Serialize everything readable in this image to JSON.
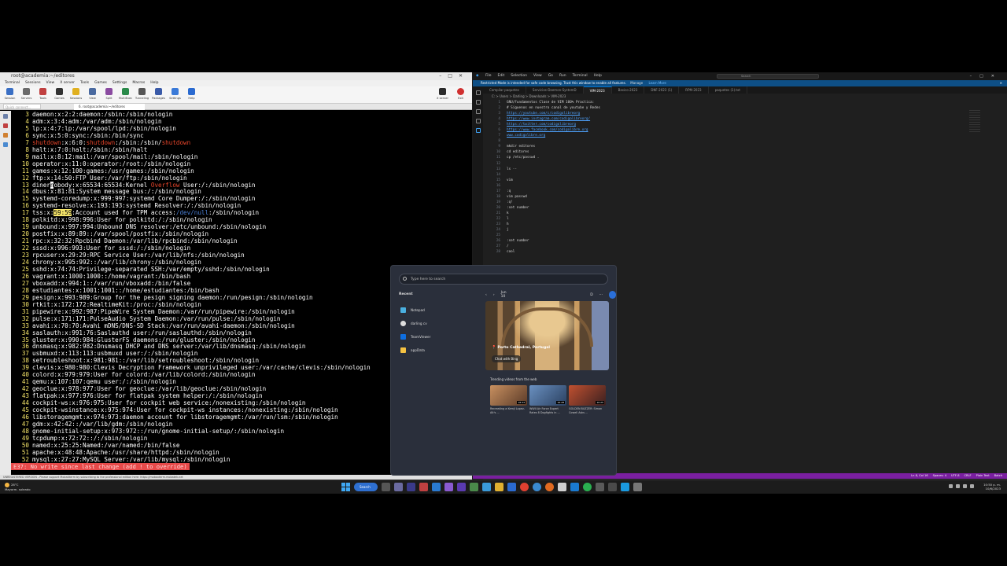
{
  "moba": {
    "title": "root@academia:~/editores",
    "menu": [
      "Terminal",
      "Sessions",
      "View",
      "X server",
      "Tools",
      "Games",
      "Settings",
      "Macros",
      "Help"
    ],
    "toolbar": [
      "Session",
      "Servers",
      "Tools",
      "Games",
      "Sessions",
      "View",
      "Split",
      "MultiExec",
      "Tunneling",
      "Packages",
      "Settings",
      "Help"
    ],
    "toolbar_right": [
      "X server",
      "Exit"
    ],
    "tab_label": "6. root@academia:~/editores",
    "quick_connect": "Quick connect...",
    "lines": [
      [
        "3",
        "daemon:x:2:2:daemon:/sbin:/sbin/nologin"
      ],
      [
        "4",
        "adm:x:3:4:adm:/var/adm:/sbin/nologin"
      ],
      [
        "5",
        "lp:x:4:7:lp:/var/spool/lpd:/sbin/nologin"
      ],
      [
        "6",
        "sync:x:5:0:sync:/sbin:/bin/sync"
      ],
      [
        "7",
        "shutdown:x:6:0:shutdown:/sbin:/sbin/shutdown"
      ],
      [
        "8",
        "halt:x:7:0:halt:/sbin:/sbin/halt"
      ],
      [
        "9",
        "mail:x:8:12:mail:/var/spool/mail:/sbin/nologin"
      ],
      [
        "10",
        "operator:x:11:0:operator:/root:/sbin/nologin"
      ],
      [
        "11",
        "games:x:12:100:games:/usr/games:/sbin/nologin"
      ],
      [
        "12",
        "ftp:x:14:50:FTP User:/var/ftp:/sbin/nologin"
      ],
      [
        "13",
        "dinernobody:x:65534:65534:Kernel Overflow User:/:/sbin/nologin"
      ],
      [
        "14",
        "dbus:x:81:81:System message bus:/:/sbin/nologin"
      ],
      [
        "15",
        "systemd-coredump:x:999:997:systemd Core Dumper:/:/sbin/nologin"
      ],
      [
        "16",
        "systemd-resolve:x:193:193:systemd Resolver:/:/sbin/nologin"
      ],
      [
        "17",
        "tss:x:59:59:Account used for TPM access:/dev/null:/sbin/nologin"
      ],
      [
        "18",
        "polkitd:x:998:996:User for polkitd:/:/sbin/nologin"
      ],
      [
        "19",
        "unbound:x:997:994:Unbound DNS resolver:/etc/unbound:/sbin/nologin"
      ],
      [
        "20",
        "postfix:x:89:89::/var/spool/postfix:/sbin/nologin"
      ],
      [
        "21",
        "rpc:x:32:32:Rpcbind Daemon:/var/lib/rpcbind:/sbin/nologin"
      ],
      [
        "22",
        "sssd:x:996:993:User for sssd:/:/sbin/nologin"
      ],
      [
        "23",
        "rpcuser:x:29:29:RPC Service User:/var/lib/nfs:/sbin/nologin"
      ],
      [
        "24",
        "chrony:x:995:992::/var/lib/chrony:/sbin/nologin"
      ],
      [
        "25",
        "sshd:x:74:74:Privilege-separated SSH:/var/empty/sshd:/sbin/nologin"
      ],
      [
        "26",
        "vagrant:x:1000:1000::/home/vagrant:/bin/bash"
      ],
      [
        "27",
        "vboxadd:x:994:1::/var/run/vboxadd:/bin/false"
      ],
      [
        "28",
        "estudiantes:x:1001:1001::/home/estudiantes:/bin/bash"
      ],
      [
        "29",
        "pesign:x:993:989:Group for the pesign signing daemon:/run/pesign:/sbin/nologin"
      ],
      [
        "30",
        "rtkit:x:172:172:RealtimeKit:/proc:/sbin/nologin"
      ],
      [
        "31",
        "pipewire:x:992:987:PipeWire System Daemon:/var/run/pipewire:/sbin/nologin"
      ],
      [
        "32",
        "pulse:x:171:171:PulseAudio System Daemon:/var/run/pulse:/sbin/nologin"
      ],
      [
        "33",
        "avahi:x:70:70:Avahi mDNS/DNS-SD Stack:/var/run/avahi-daemon:/sbin/nologin"
      ],
      [
        "34",
        "saslauth:x:991:76:Saslauthd user:/run/saslauthd:/sbin/nologin"
      ],
      [
        "35",
        "gluster:x:990:984:GlusterFS daemons:/run/gluster:/sbin/nologin"
      ],
      [
        "36",
        "dnsmasq:x:982:982:Dnsmasq DHCP and DNS server:/var/lib/dnsmasq:/sbin/nologin"
      ],
      [
        "37",
        "usbmuxd:x:113:113:usbmuxd user:/:/sbin/nologin"
      ],
      [
        "38",
        "setroubleshoot:x:981:981::/var/lib/setroubleshoot:/sbin/nologin"
      ],
      [
        "39",
        "clevis:x:980:980:Clevis Decryption Framework unprivileged user:/var/cache/clevis:/sbin/nologin"
      ],
      [
        "40",
        "colord:x:979:979:User for colord:/var/lib/colord:/sbin/nologin"
      ],
      [
        "41",
        "qemu:x:107:107:qemu user:/:/sbin/nologin"
      ],
      [
        "42",
        "geoclue:x:978:977:User for geoclue:/var/lib/geoclue:/sbin/nologin"
      ],
      [
        "43",
        "flatpak:x:977:976:User for flatpak system helper:/:/sbin/nologin"
      ],
      [
        "44",
        "cockpit-ws:x:976:975:User for cockpit web service:/nonexisting:/sbin/nologin"
      ],
      [
        "45",
        "cockpit-wsinstance:x:975:974:User for cockpit-ws instances:/nonexisting:/sbin/nologin"
      ],
      [
        "46",
        "libstoragemgmt:x:974:973:daemon account for libstoragemgmt:/var/run/lsm:/sbin/nologin"
      ],
      [
        "47",
        "gdm:x:42:42::/var/lib/gdm:/sbin/nologin"
      ],
      [
        "48",
        "gnome-initial-setup:x:973:972::/run/gnome-initial-setup/:/sbin/nologin"
      ],
      [
        "49",
        "tcpdump:x:72:72::/:/sbin/nologin"
      ],
      [
        "50",
        "named:x:25:25:Named:/var/named:/bin/false"
      ],
      [
        "51",
        "apache:x:48:48:Apache:/usr/share/httpd:/sbin/nologin"
      ],
      [
        "52",
        "mysql:x:27:27:MySQL Server:/var/lib/mysql:/sbin/nologin"
      ]
    ],
    "error": "E37: No write since last change (add ! to override)",
    "status": "UNREGISTERED VERSION  -  Please support MobaXterm by subscribing to the professional edition here:  https://mobaxterm.mobatek.net"
  },
  "vscode": {
    "menu": [
      "File",
      "Edit",
      "Selection",
      "View",
      "Go",
      "Run",
      "Terminal",
      "Help"
    ],
    "search": "Search",
    "banner": "Restricted Mode is intended for safe code browsing. Trust this window to enable all features.",
    "banner_manage": "Manage",
    "banner_learn": "Learn More",
    "tabs": [
      "Compilar paquetes",
      "Servicios-Daemon-SystemD",
      "VIM-2023",
      "Basico-2023",
      "DNF-2023 (1)",
      "RPM-2023",
      "paquetes (1).txt"
    ],
    "breadcrumb": "C: > Users > Darling > Downloads > VIM-2023",
    "code": [
      [
        "1",
        "GNU/Fundamentos Clase de VIM 100% Practica:"
      ],
      [
        "2",
        "# Siguenos en nuestro canal de youtube y Redes"
      ],
      [
        "3",
        "https://youtube.com/c/codigolibreorg"
      ],
      [
        "4",
        "https://www.instagram.com/codigolibreorg/"
      ],
      [
        "5",
        "https://twitter.com/codigolibreorg"
      ],
      [
        "6",
        "https://www.facebook.com/codigolibre.org"
      ],
      [
        "7",
        "www.codigolibre.org"
      ],
      [
        "8",
        ""
      ],
      [
        "9",
        "mkdir editores"
      ],
      [
        "10",
        "cd editores"
      ],
      [
        "11",
        "cp /etc/passwd ."
      ],
      [
        "12",
        ""
      ],
      [
        "13",
        "ls --"
      ],
      [
        "14",
        ""
      ],
      [
        "15",
        "vim"
      ],
      [
        "16",
        ""
      ],
      [
        "17",
        ":q"
      ],
      [
        "18",
        "vim passwd"
      ],
      [
        "19",
        ":q!"
      ],
      [
        "20",
        ":set number"
      ],
      [
        "21",
        "k"
      ],
      [
        "22",
        "l"
      ],
      [
        "23",
        "h"
      ],
      [
        "24",
        "j"
      ],
      [
        "25",
        ""
      ],
      [
        "26",
        ":set number"
      ],
      [
        "27",
        "/"
      ],
      [
        "28",
        "cool"
      ]
    ],
    "status": [
      "Ln 8, Col 16",
      "Spaces: 4",
      "UTF-8",
      "CRLF",
      "Plain Text",
      "Batch"
    ]
  },
  "start": {
    "search_placeholder": "Type here to search",
    "recent_label": "Recent",
    "recent": [
      "Notepad",
      "darling cv",
      "TeamViewer",
      "appData"
    ],
    "date": "Jun 10",
    "d_label": "D",
    "hero_caption": "Porto Cathedral, Portugal",
    "chat_label": "Chat with Bing",
    "trending_label": "Trending videos from the web",
    "videos": [
      {
        "caption": "Recreating a Kemji Lopez-Alt's ...",
        "duration": "18:33"
      },
      {
        "caption": "WWII Air Force Expert Rates 8 Dogfights in ...",
        "duration": "16:28"
      },
      {
        "caption": "GOLDEN BUZZER: Simon Cowell Asks ...",
        "duration": "10:25"
      }
    ]
  },
  "taskbar": {
    "weather_temp": "28°C",
    "weather_desc": "Mayorm. soleado",
    "search_label": "Search",
    "time": "10:50 p. m.",
    "date": "10/6/2023"
  }
}
